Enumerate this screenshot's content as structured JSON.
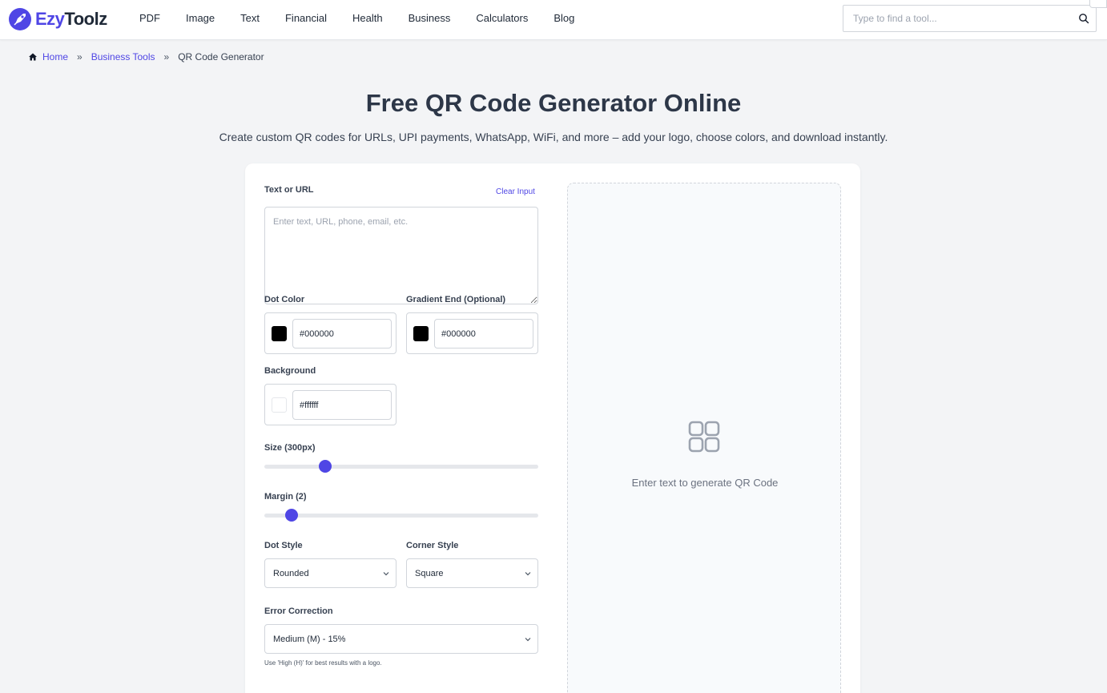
{
  "header": {
    "logo": {
      "prefix": "Ezy",
      "suffix": "Toolz"
    },
    "nav": [
      "PDF",
      "Image",
      "Text",
      "Financial",
      "Health",
      "Business",
      "Calculators",
      "Blog"
    ],
    "search": {
      "placeholder": "Type to find a tool...",
      "value": "",
      "icon": "search-icon"
    }
  },
  "breadcrumb": {
    "home_icon": "home-icon",
    "items": [
      "Home",
      "Business Tools",
      "QR Code Generator"
    ],
    "separator": "»"
  },
  "page": {
    "title": "Free QR Code Generator Online",
    "subtitle": "Create custom QR codes for URLs, UPI payments, WhatsApp, WiFi, and more – add your logo, choose colors, and download instantly."
  },
  "form": {
    "text_label": "Text or URL",
    "clear_label": "Clear Input",
    "text_placeholder": "Enter text, URL, phone, email, etc.",
    "text_value": "",
    "dot_color": {
      "label": "Dot Color",
      "value": "#000000",
      "swatch": "#000000"
    },
    "gradient_end": {
      "label": "Gradient End (Optional)",
      "value": "#000000",
      "swatch": "#000000"
    },
    "background": {
      "label": "Background",
      "value": "#ffffff",
      "swatch": "#ffffff"
    },
    "size": {
      "label": "Size (300px)",
      "value": 300,
      "min": 100,
      "max": 1000
    },
    "margin": {
      "label": "Margin (2)",
      "value": 2,
      "min": 0,
      "max": 20
    },
    "dot_style": {
      "label": "Dot Style",
      "value": "Rounded"
    },
    "corner_style": {
      "label": "Corner Style",
      "value": "Square"
    },
    "error_correction": {
      "label": "Error Correction",
      "value": "Medium (M) - 15%",
      "hint": "Use 'High (H)' for best results with a logo."
    }
  },
  "preview": {
    "icon": "qr-placeholder-icon",
    "message": "Enter text to generate QR Code"
  },
  "colors": {
    "accent": "#4f46e5",
    "title": "#2d3748",
    "background": "#f3f4f6"
  }
}
